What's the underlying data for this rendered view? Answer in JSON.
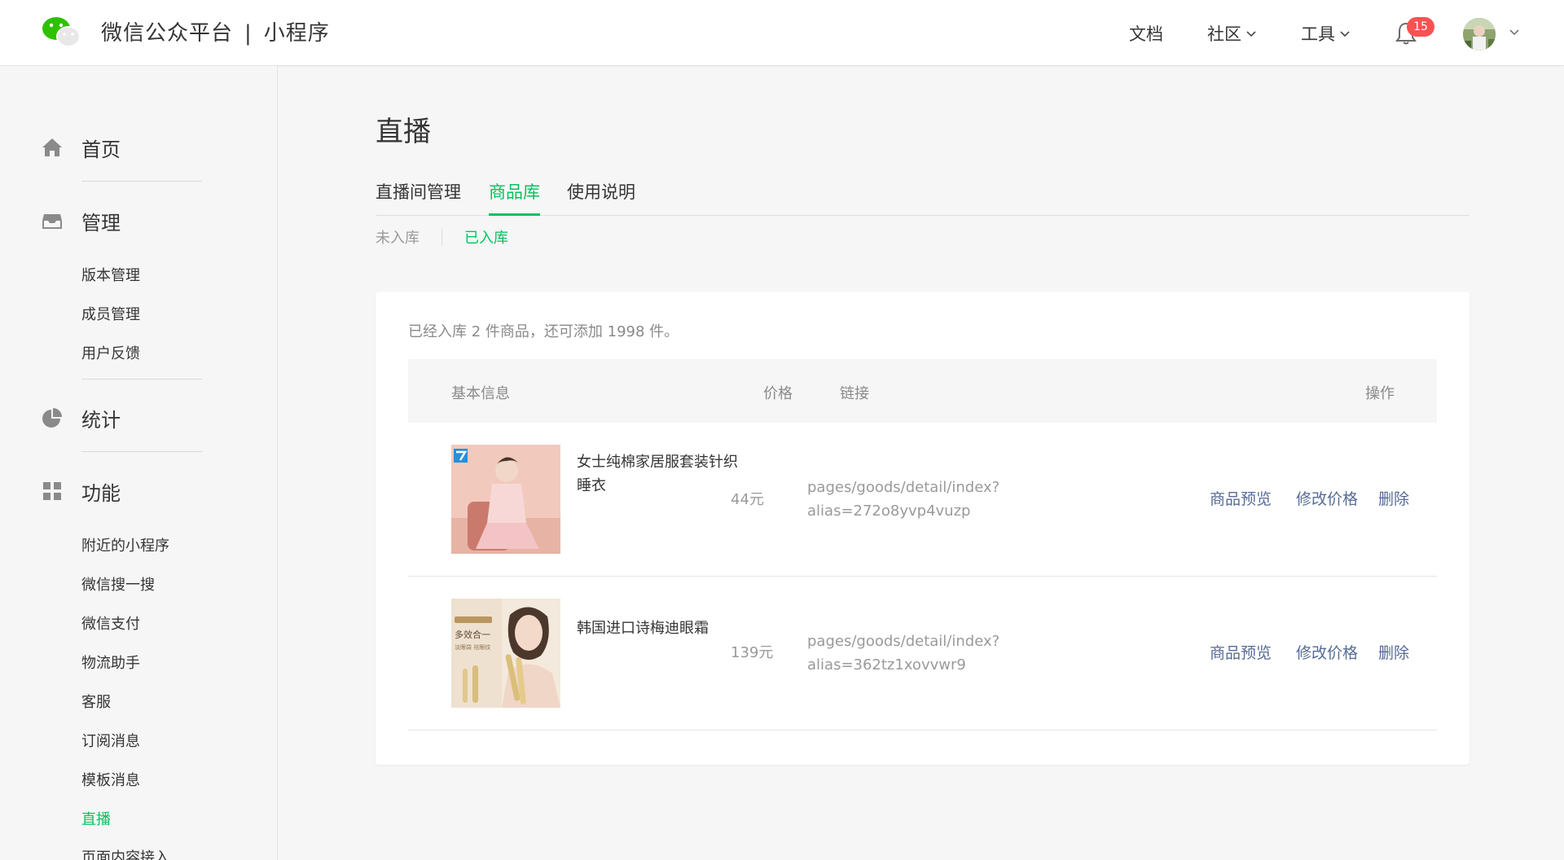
{
  "header": {
    "brand": "微信公众平台",
    "separator": "|",
    "product": "小程序",
    "nav": [
      {
        "label": "文档"
      },
      {
        "label": "社区"
      },
      {
        "label": "工具"
      }
    ],
    "notification_count": "15",
    "accent_color": "#07c160"
  },
  "sidebar": {
    "home": "首页",
    "manage": {
      "label": "管理",
      "items": [
        "版本管理",
        "成员管理",
        "用户反馈"
      ]
    },
    "stats": "统计",
    "features": {
      "label": "功能",
      "items": [
        "附近的小程序",
        "微信搜一搜",
        "微信支付",
        "物流助手",
        "客服",
        "订阅消息",
        "模板消息",
        "直播",
        "页面内容接入"
      ]
    },
    "active_item": "直播"
  },
  "main": {
    "title": "直播",
    "tabs": [
      "直播间管理",
      "商品库",
      "使用说明"
    ],
    "active_tab": "商品库",
    "subtabs": [
      "未入库",
      "已入库"
    ],
    "active_subtab": "已入库",
    "summary": "已经入库 2 件商品，还可添加 1998 件。",
    "table": {
      "headers": {
        "info": "基本信息",
        "price": "价格",
        "link": "链接",
        "ops": "操作"
      },
      "rows": [
        {
          "name_line1": "女士纯棉家居服套装针织",
          "name_line2": "睡衣",
          "price": "44元",
          "link_line1": "pages/goods/detail/index?",
          "link_line2": "alias=272o8yvp4vuzp",
          "ops": [
            "商品预览",
            "修改价格",
            "删除"
          ]
        },
        {
          "name_line1": "韩国进口诗梅迪眼霜",
          "name_line2": "",
          "price": "139元",
          "link_line1": "pages/goods/detail/index?",
          "link_line2": "alias=362tz1xovvwr9",
          "ops": [
            "商品预览",
            "修改价格",
            "删除"
          ],
          "thumb_text_1": "多效合一",
          "thumb_text_2": "淡眼袋 祛眼纹"
        }
      ]
    }
  }
}
